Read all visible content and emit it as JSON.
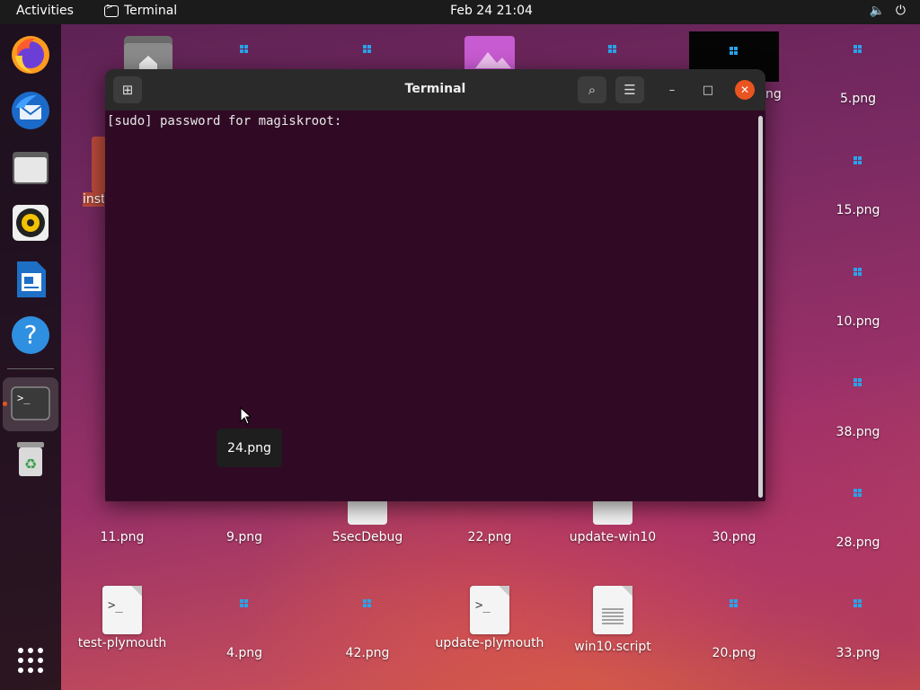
{
  "topbar": {
    "activities": "Activities",
    "app_name": "Terminal",
    "clock": "Feb 24  21:04",
    "volume_icon": "🔈",
    "power_icon": "⏻"
  },
  "dock": {
    "items": [
      "Firefox",
      "Thunderbird",
      "Files",
      "Rhythmbox",
      "LibreOffice Writer",
      "Help",
      "Terminal",
      "Trash",
      "Show Applications"
    ]
  },
  "desktop": {
    "partial_label": "inst",
    "partial_png_label": "ng",
    "icons": [
      {
        "label": "5.png"
      },
      {
        "label": "15.png"
      },
      {
        "label": "10.png"
      },
      {
        "label": "38.png"
      },
      {
        "label": "11.png"
      },
      {
        "label": "9.png"
      },
      {
        "label": "5secDebug"
      },
      {
        "label": "22.png"
      },
      {
        "label": "update-win10"
      },
      {
        "label": "30.png"
      },
      {
        "label": "28.png"
      },
      {
        "label": "test-plymouth"
      },
      {
        "label": "4.png"
      },
      {
        "label": "42.png"
      },
      {
        "label": "update-plymouth"
      },
      {
        "label": "win10.script"
      },
      {
        "label": "20.png"
      },
      {
        "label": "33.png"
      }
    ]
  },
  "terminal": {
    "title": "Terminal",
    "new_tab_icon": "⊞",
    "search_icon": "⌕",
    "menu_icon": "☰",
    "minimize": "–",
    "maximize": "□",
    "close": "✕",
    "output": "[sudo] password for magiskroot: "
  },
  "tooltip": {
    "text": "24.png"
  }
}
